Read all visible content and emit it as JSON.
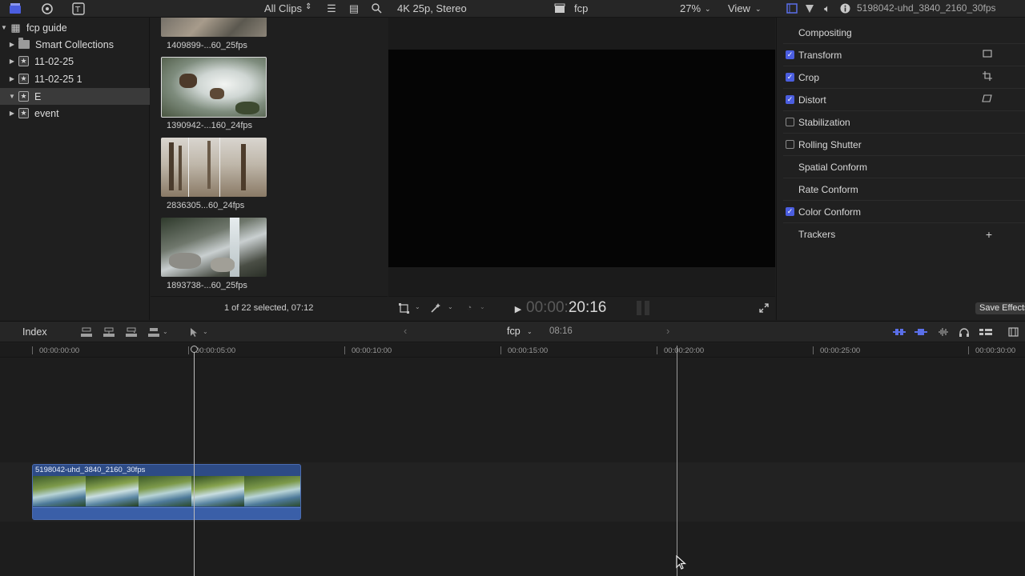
{
  "topbar": {
    "all_clips": "All Clips",
    "viewer_format": "4K 25p, Stereo",
    "project_name": "fcp",
    "zoom": "27%",
    "view_menu": "View",
    "inspector_clip_name": "5198042-uhd_3840_2160_30fps"
  },
  "sidebar": {
    "library_name": "fcp guide",
    "items": [
      {
        "label": "Smart Collections"
      },
      {
        "label": "11-02-25"
      },
      {
        "label": "11-02-25 1"
      },
      {
        "label": "E"
      },
      {
        "label": "event"
      }
    ]
  },
  "browser": {
    "clips": [
      {
        "label": "1409899-...60_25fps"
      },
      {
        "label": "1390942-...160_24fps"
      },
      {
        "label": "2836305...60_24fps"
      },
      {
        "label": "1893738-...60_25fps"
      }
    ],
    "status": "1 of 22 selected, 07:12"
  },
  "viewer": {
    "timecode_dim": "00:00:",
    "timecode_bright": "20:16"
  },
  "inspector": {
    "rows": [
      {
        "label": "Compositing",
        "checked": null,
        "icon": ""
      },
      {
        "label": "Transform",
        "checked": true,
        "icon": "transform-icon"
      },
      {
        "label": "Crop",
        "checked": true,
        "icon": "crop-icon"
      },
      {
        "label": "Distort",
        "checked": true,
        "icon": "distort-icon"
      },
      {
        "label": "Stabilization",
        "checked": false,
        "icon": ""
      },
      {
        "label": "Rolling Shutter",
        "checked": false,
        "icon": ""
      },
      {
        "label": "Spatial Conform",
        "checked": null,
        "icon": ""
      },
      {
        "label": "Rate Conform",
        "checked": null,
        "icon": ""
      },
      {
        "label": "Color Conform",
        "checked": true,
        "icon": ""
      },
      {
        "label": "Trackers",
        "checked": null,
        "icon": "plus-icon"
      }
    ],
    "save_effects": "Save Effects"
  },
  "timeline_toolbar": {
    "index": "Index",
    "project_name": "fcp",
    "duration": "08:16"
  },
  "ruler": {
    "labels": [
      "00:00:00:00",
      "00:00:05:00",
      "00:00:10:00",
      "00:00:15:00",
      "00:00:20:00",
      "00:00:25:00",
      "00:00:30:00"
    ]
  },
  "timeline": {
    "clip_name": "5198042-uhd_3840_2160_30fps"
  },
  "colors": {
    "accent": "#4b5ee0",
    "clip": "#2d4b86"
  }
}
